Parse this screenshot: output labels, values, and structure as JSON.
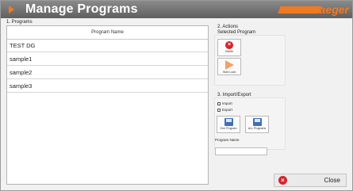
{
  "window": {
    "title": "Manage Programs",
    "brand": "Haeger",
    "accent_color": "#f07a22"
  },
  "programs": {
    "section_label": "1. Programs",
    "column_header": "Program Name",
    "rows": [
      "TEST DG",
      "sample1",
      "sample2",
      "sample3"
    ]
  },
  "actions": {
    "section_label": "2. Actions",
    "selected_label": "Selected Program",
    "delete_label": "Delete",
    "start_label": "Start Load",
    "delete_icon": "delete-circle-icon",
    "start_icon": "play-arrow-icon"
  },
  "import_export": {
    "section_label": "3. Import/Export",
    "import_label": "Import",
    "export_label": "Export",
    "one_program_label": "One Program",
    "all_programs_label": "ALL Programs",
    "program_name_label": "Program Name",
    "program_name_value": ""
  },
  "footer": {
    "close_label": "Close",
    "close_icon": "close-circle-icon"
  }
}
